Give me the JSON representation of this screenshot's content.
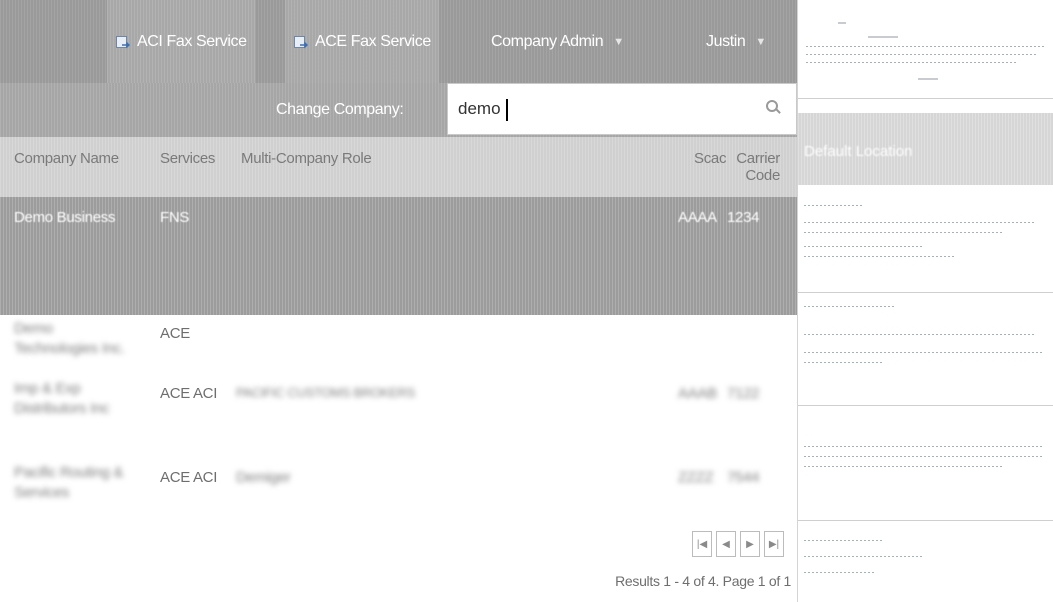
{
  "topbar": {
    "aci_fax": "ACI Fax Service",
    "ace_fax": "ACE Fax Service",
    "company_admin": "Company Admin",
    "user": "Justin"
  },
  "search": {
    "label": "Change Company:",
    "value": "demo"
  },
  "table": {
    "headers": {
      "company": "Company Name",
      "services": "Services",
      "role": "Multi-Company Role",
      "scac": "Scac",
      "carrier": "Carrier Code"
    },
    "rows": [
      {
        "company": "Demo Business",
        "services": "FNS",
        "role": "",
        "scac": "AAAA",
        "carrier": "1234"
      },
      {
        "company": "Demo Technologies Inc.",
        "services": "ACE",
        "role": "",
        "scac": "",
        "carrier": ""
      },
      {
        "company": "Imp & Exp Distributors Inc",
        "services": "ACE ACI",
        "role": "PACIFIC CUSTOMS BROKERS",
        "scac": "AAAB",
        "carrier": "7122"
      },
      {
        "company": "Pacific Routing & Services",
        "services": "ACE ACI",
        "role": "Demiger",
        "scac": "ZZZZ",
        "carrier": "7544"
      }
    ]
  },
  "pager": {
    "first": "|◀",
    "prev": "◀",
    "next": "▶",
    "last": "▶|",
    "results": "Results 1 - 4 of 4. Page 1 of 1"
  },
  "side": {
    "band_text": "Default Location"
  }
}
